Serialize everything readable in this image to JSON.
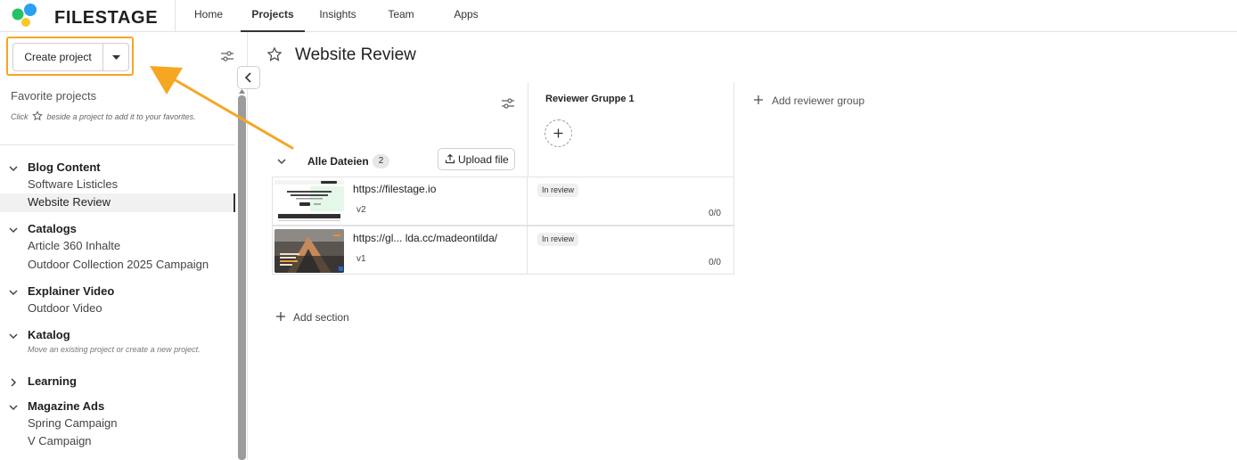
{
  "brand": {
    "name": "FILESTAGE"
  },
  "nav": {
    "items": [
      {
        "label": "Home"
      },
      {
        "label": "Projects",
        "active": true
      },
      {
        "label": "Insights"
      },
      {
        "label": "Team"
      },
      {
        "label": "Apps"
      }
    ]
  },
  "sidebar": {
    "create_label": "Create project",
    "favorites_title": "Favorite projects",
    "favorites_hint_before": "Click",
    "favorites_hint_after": "beside a project to add it to your favorites.",
    "groups": [
      {
        "name": "Blog Content",
        "expanded": true,
        "projects": [
          "Software Listicles",
          "Website Review"
        ]
      },
      {
        "name": "Catalogs",
        "expanded": true,
        "projects": [
          "Article 360 Inhalte",
          "Outdoor Collection 2025 Campaign"
        ]
      },
      {
        "name": "Explainer Video",
        "expanded": true,
        "projects": [
          "Outdoor Video"
        ]
      },
      {
        "name": "Katalog",
        "expanded": true,
        "projects": [],
        "empty_hint": "Move an existing project or create a new project."
      },
      {
        "name": "Learning",
        "expanded": false,
        "projects": []
      },
      {
        "name": "Magazine Ads",
        "expanded": true,
        "projects": [
          "Spring Campaign",
          "V Campaign"
        ]
      }
    ],
    "active_project": "Website Review"
  },
  "main": {
    "title": "Website Review",
    "reviewer_group": "Reviewer Gruppe 1",
    "add_reviewer_group": "Add reviewer group",
    "section": {
      "name": "Alle Dateien",
      "count": "2",
      "upload_label": "Upload file"
    },
    "files": [
      {
        "name": "https://filestage.io",
        "version": "v2",
        "status": "In review",
        "count": "0/0"
      },
      {
        "name": "https://gl... lda.cc/madeontilda/",
        "version": "v1",
        "status": "In review",
        "count": "0/0"
      }
    ],
    "add_section": "Add section"
  },
  "colors": {
    "highlight": "#f5a623",
    "accent_blue": "#2aa0f0",
    "accent_green": "#27c267",
    "accent_yellow": "#f7c928"
  }
}
